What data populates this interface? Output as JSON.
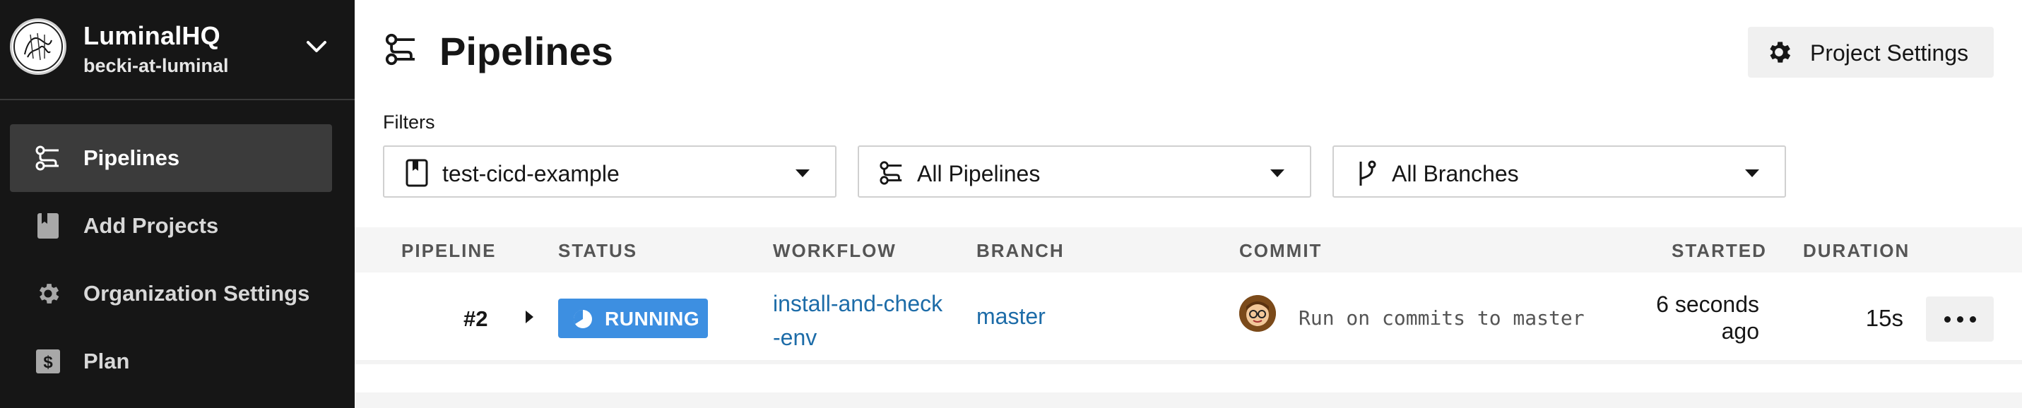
{
  "org": {
    "name": "LuminalHQ",
    "user": "becki-at-luminal"
  },
  "sidebar": {
    "items": [
      {
        "label": "Pipelines",
        "icon": "pipelines-icon",
        "active": true
      },
      {
        "label": "Add Projects",
        "icon": "book-icon",
        "active": false
      },
      {
        "label": "Organization Settings",
        "icon": "gear-icon",
        "active": false
      },
      {
        "label": "Plan",
        "icon": "dollar-icon",
        "active": false
      }
    ]
  },
  "header": {
    "title": "Pipelines",
    "settings_label": "Project Settings"
  },
  "filters": {
    "label": "Filters",
    "project": "test-cicd-example",
    "pipelines": "All Pipelines",
    "branches": "All Branches"
  },
  "table": {
    "columns": [
      "PIPELINE",
      "STATUS",
      "WORKFLOW",
      "BRANCH",
      "COMMIT",
      "STARTED",
      "DURATION"
    ],
    "rows": [
      {
        "pipeline": "#2",
        "status": "RUNNING",
        "workflow_line1": "install-and-check",
        "workflow_line2": "-env",
        "branch": "master",
        "commit": "Run on commits to master",
        "started_line1": "6 seconds",
        "started_line2": "ago",
        "duration": "15s"
      }
    ]
  },
  "colors": {
    "sidebar_bg": "#161616",
    "active_item_bg": "#3b3b3b",
    "status_running": "#3d8fe1",
    "link": "#1d6ca8"
  }
}
